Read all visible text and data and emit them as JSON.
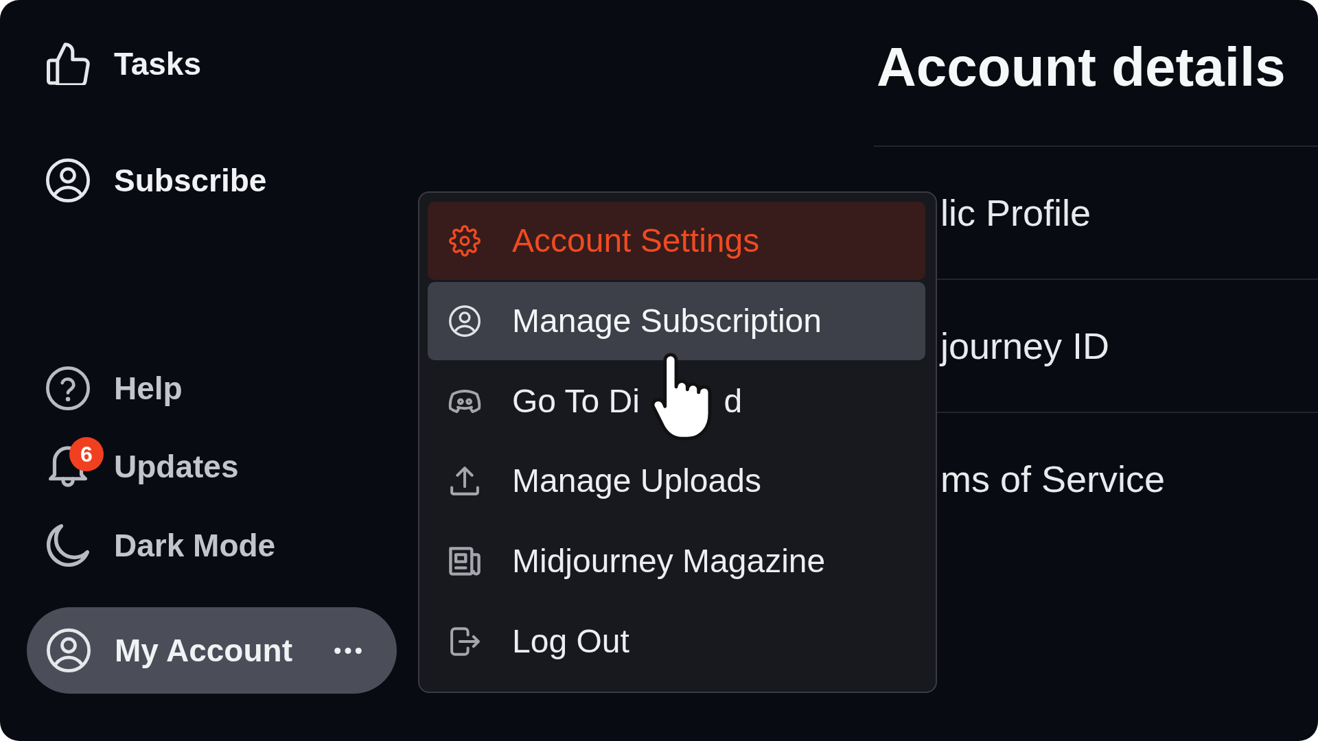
{
  "sidebar": {
    "nav_items": [
      {
        "label": "Tasks"
      },
      {
        "label": "Subscribe"
      }
    ],
    "utility_items": [
      {
        "label": "Help"
      },
      {
        "label": "Updates",
        "badge": "6"
      },
      {
        "label": "Dark Mode"
      }
    ],
    "account": {
      "label": "My Account",
      "expanded": true
    }
  },
  "account_menu": {
    "items": [
      {
        "label": "Account Settings",
        "selected": true,
        "hovered": false
      },
      {
        "label": "Manage Subscription",
        "selected": false,
        "hovered": true
      },
      {
        "label": "Go To Di",
        "cursor_over": true,
        "label_after_cursor": "d",
        "selected": false,
        "hovered": false
      },
      {
        "label": "Manage Uploads",
        "selected": false,
        "hovered": false
      },
      {
        "label": "Midjourney Magazine",
        "selected": false,
        "hovered": false
      },
      {
        "label": "Log Out",
        "selected": false,
        "hovered": false
      }
    ]
  },
  "content": {
    "title": "Account details",
    "rows": [
      {
        "label": "lic Profile"
      },
      {
        "label": "journey ID"
      },
      {
        "label": "ms of Service"
      }
    ]
  }
}
